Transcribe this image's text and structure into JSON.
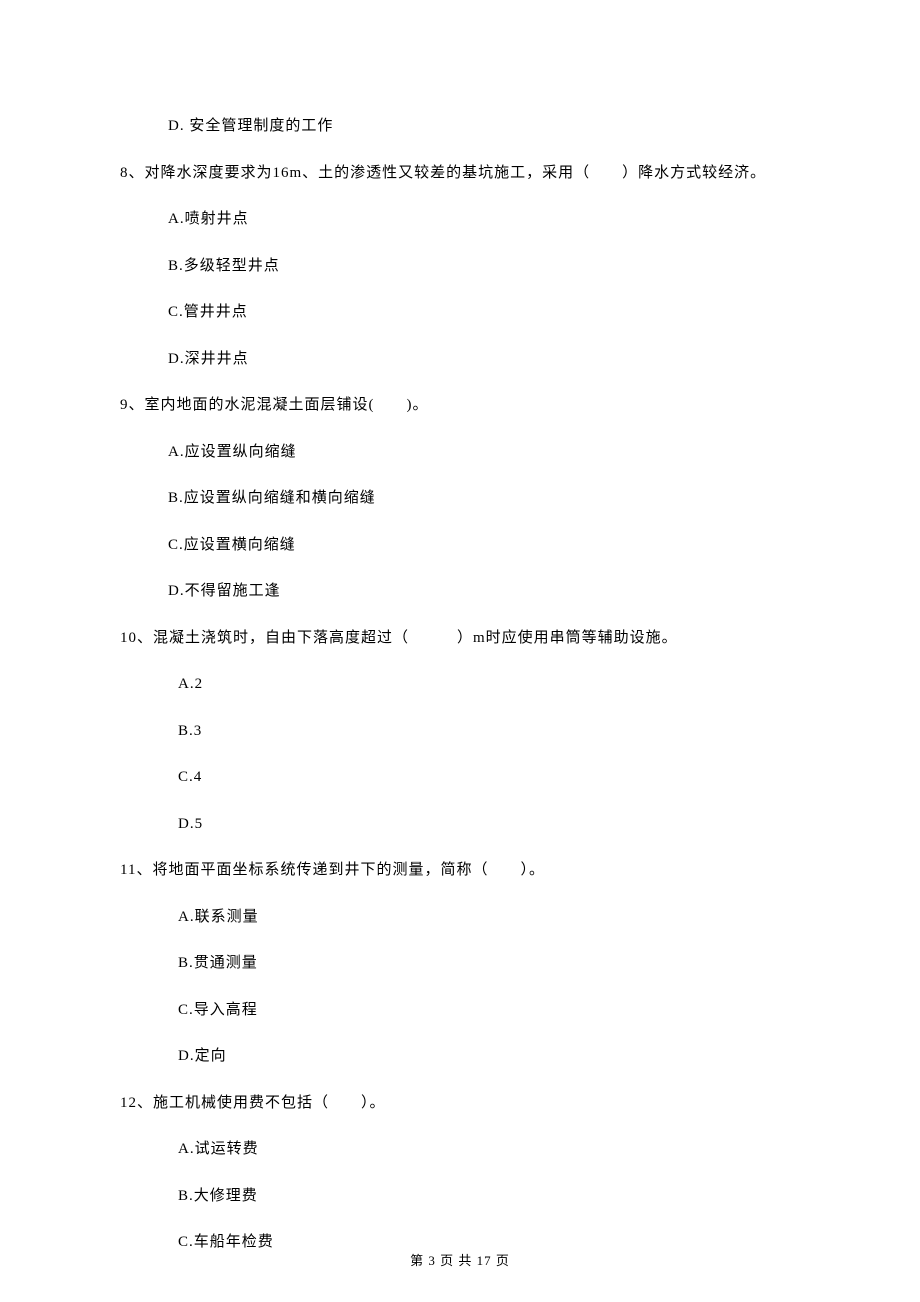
{
  "q7": {
    "options": {
      "d": "D. 安全管理制度的工作"
    }
  },
  "q8": {
    "text": "8、对降水深度要求为16m、土的渗透性又较差的基坑施工，采用（　　）降水方式较经济。",
    "options": {
      "a": "A.喷射井点",
      "b": "B.多级轻型井点",
      "c": "C.管井井点",
      "d": "D.深井井点"
    }
  },
  "q9": {
    "text": "9、室内地面的水泥混凝土面层铺设(　　)。",
    "options": {
      "a": "A.应设置纵向缩缝",
      "b": "B.应设置纵向缩缝和横向缩缝",
      "c": "C.应设置横向缩缝",
      "d": "D.不得留施工逢"
    }
  },
  "q10": {
    "text": "10、混凝土浇筑时，自由下落高度超过（　　　）m时应使用串筒等辅助设施。",
    "options": {
      "a": "A.2",
      "b": "B.3",
      "c": "C.4",
      "d": "D.5"
    }
  },
  "q11": {
    "text": "11、将地面平面坐标系统传递到井下的测量，简称（　　）。",
    "options": {
      "a": "A.联系测量",
      "b": "B.贯通测量",
      "c": "C.导入高程",
      "d": "D.定向"
    }
  },
  "q12": {
    "text": "12、施工机械使用费不包括（　　）。",
    "options": {
      "a": "A.试运转费",
      "b": "B.大修理费",
      "c": "C.车船年检费"
    }
  },
  "footer": "第 3 页 共 17 页"
}
